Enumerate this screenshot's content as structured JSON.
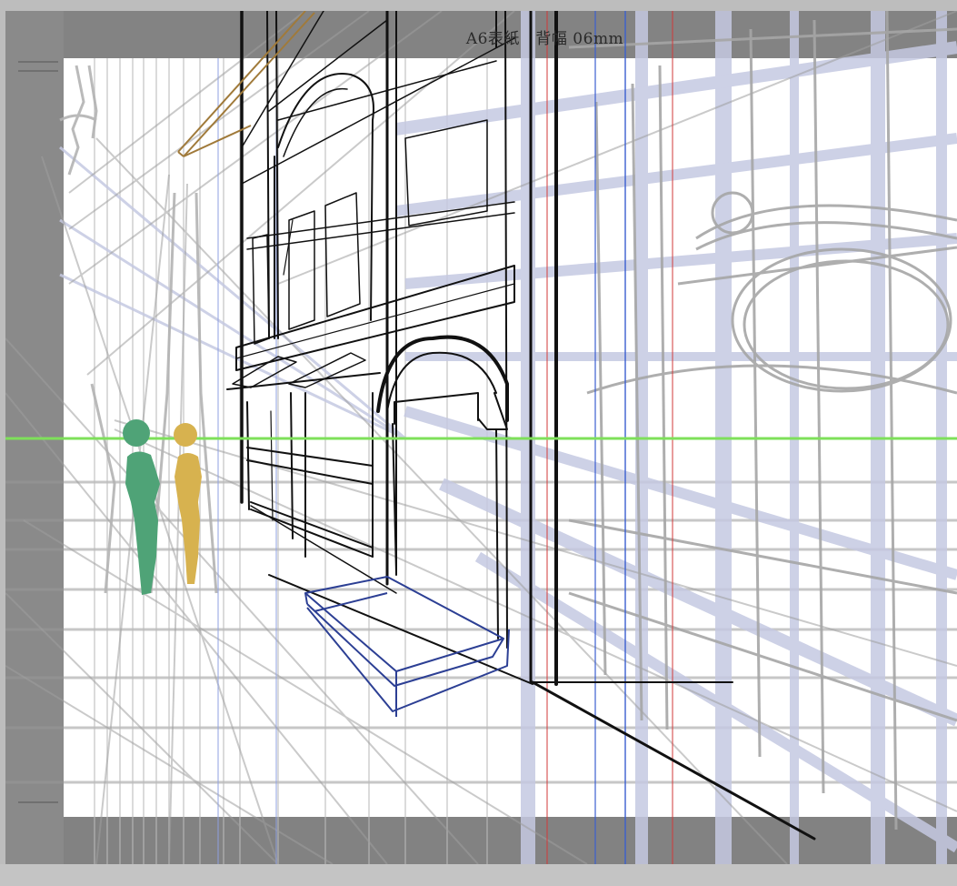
{
  "document": {
    "title": "A6表紙　背幅 06mm"
  },
  "colors": {
    "workspace": "#8a8a8a",
    "paper": "#ffffff",
    "horizon_line": "#7ee05a",
    "guide_blue": "#3355cc",
    "guide_red": "#d23a3a",
    "perspective_ruler": "#bfc4df",
    "figure_green": "#4fa377",
    "figure_yellow": "#d7b24f",
    "box_sketch": "#2c3f94",
    "sign_sketch": "#a07a3a"
  },
  "layers": {
    "horizon": "eye-level-line",
    "figures": [
      "figure-green",
      "figure-yellow"
    ],
    "objects": [
      "building-facade",
      "arched-doorway",
      "box-sketch",
      "hanging-sign"
    ]
  }
}
